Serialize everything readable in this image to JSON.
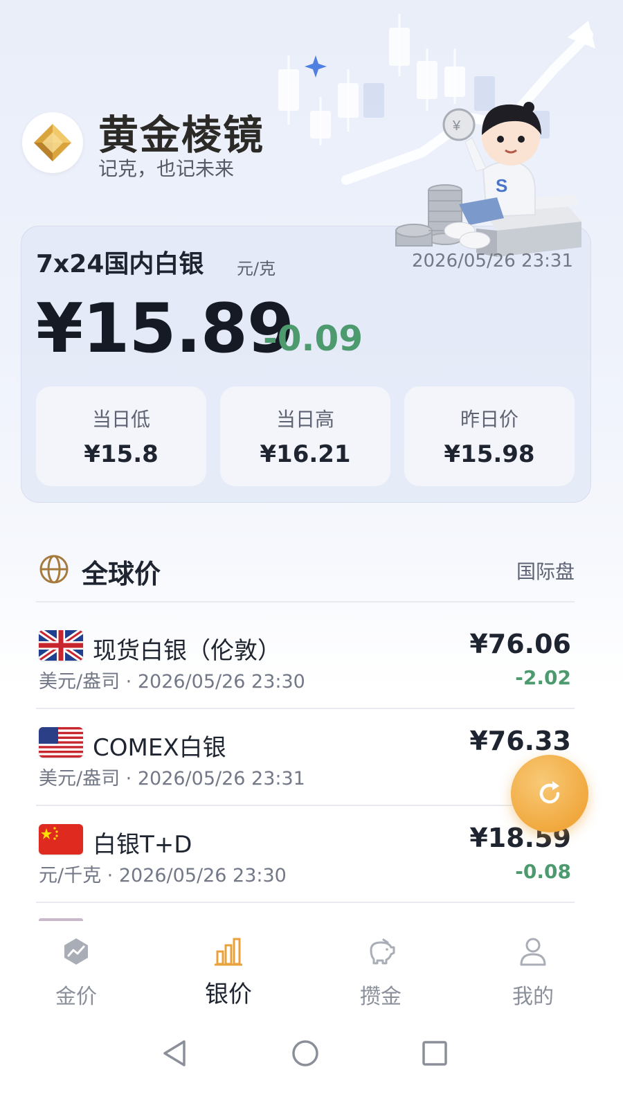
{
  "brand": {
    "name": "黄金棱镜",
    "tagline": "记克，也记未来"
  },
  "market": {
    "title": "7x24国内白银",
    "unit": "元/克",
    "timestamp": "2026/05/26 23:31",
    "price": "¥15.89",
    "change": "-0.09",
    "stats": [
      {
        "label": "当日低",
        "value": "¥15.8"
      },
      {
        "label": "当日高",
        "value": "¥16.21"
      },
      {
        "label": "昨日价",
        "value": "¥15.98"
      }
    ]
  },
  "global": {
    "title": "全球价",
    "tag": "国际盘",
    "rows": [
      {
        "flag": "uk-flag",
        "name": "现货白银（伦敦）",
        "meta": "美元/盎司 · 2026/05/26 23:30",
        "price": "¥76.06",
        "change": "-2.02"
      },
      {
        "flag": "us-flag",
        "name": "COMEX白银",
        "meta": "美元/盎司 · 2026/05/26 23:31",
        "price": "¥76.33",
        "change": ""
      },
      {
        "flag": "cn-flag",
        "name": "白银T+D",
        "meta": "元/千克 · 2026/05/26 23:30",
        "price": "¥18.59",
        "change": "-0.08"
      }
    ]
  },
  "nav": {
    "items": [
      {
        "label": "金价",
        "icon": "chart-icon"
      },
      {
        "label": "银价",
        "icon": "bar-chart-icon",
        "active": true
      },
      {
        "label": "攒金",
        "icon": "piggy-bank-icon"
      },
      {
        "label": "我的",
        "icon": "user-icon"
      }
    ]
  },
  "colors": {
    "accent": "#f1a93f",
    "down": "#4c9a6d",
    "nav_active": "#e9a23b"
  }
}
